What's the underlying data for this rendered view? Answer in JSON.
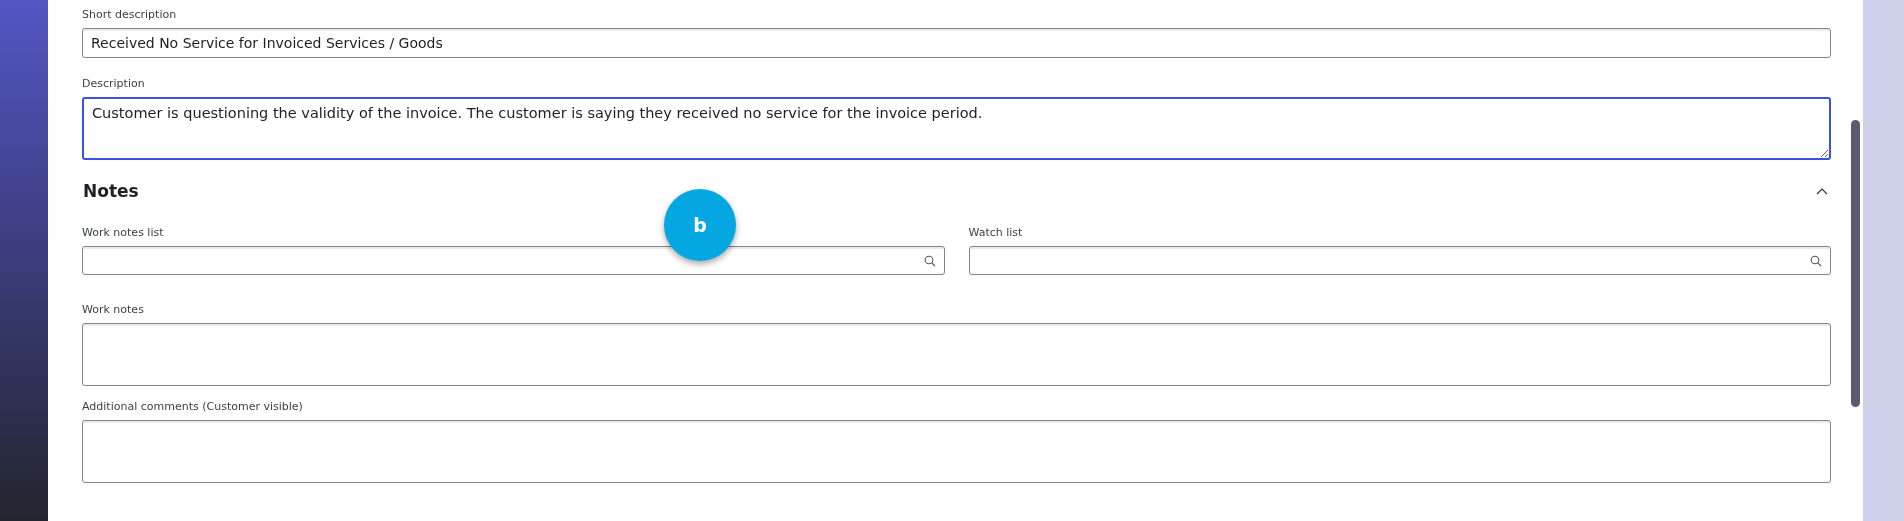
{
  "fields": [
    {
      "kind": "text",
      "label": "Short description",
      "value": "Received No Service for Invoiced Services / Goods",
      "focused": false
    },
    {
      "kind": "textarea",
      "label": "Description",
      "value": "Customer is questioning the validity of the invoice. The customer is saying they received no service for the invoice period.",
      "focused": true
    }
  ],
  "notes": {
    "title": "Notes",
    "expanded": true,
    "lookups": [
      {
        "label": "Work notes list"
      },
      {
        "label": "Watch list"
      }
    ],
    "textareas": [
      {
        "label": "Work notes"
      },
      {
        "label": "Additional comments (Customer visible)"
      }
    ]
  },
  "badge": {
    "text": "b"
  }
}
